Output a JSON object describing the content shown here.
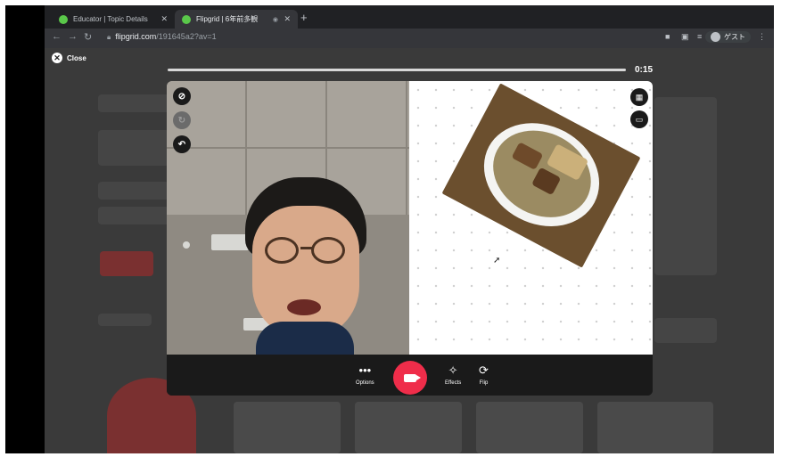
{
  "browser": {
    "tabs": [
      {
        "title": "Educator | Topic Details",
        "close": "✕"
      },
      {
        "title": "Flipgrid | 6年前多観",
        "close": "✕",
        "indicator": "◉"
      }
    ],
    "new_tab": "+",
    "url_host": "flipgrid.com",
    "url_path": "/191645a2?av=1",
    "profile_label": "ゲスト"
  },
  "recorder": {
    "close_label": "Close",
    "timer": "0:15",
    "progress": 0.0,
    "controls": [
      {
        "icon": "more-dots",
        "label": "Options"
      },
      {
        "icon": "magic-wand",
        "label": "Effects"
      },
      {
        "icon": "flip-arrows",
        "label": "Flip"
      }
    ],
    "accent_color": "#ef2d4a"
  }
}
